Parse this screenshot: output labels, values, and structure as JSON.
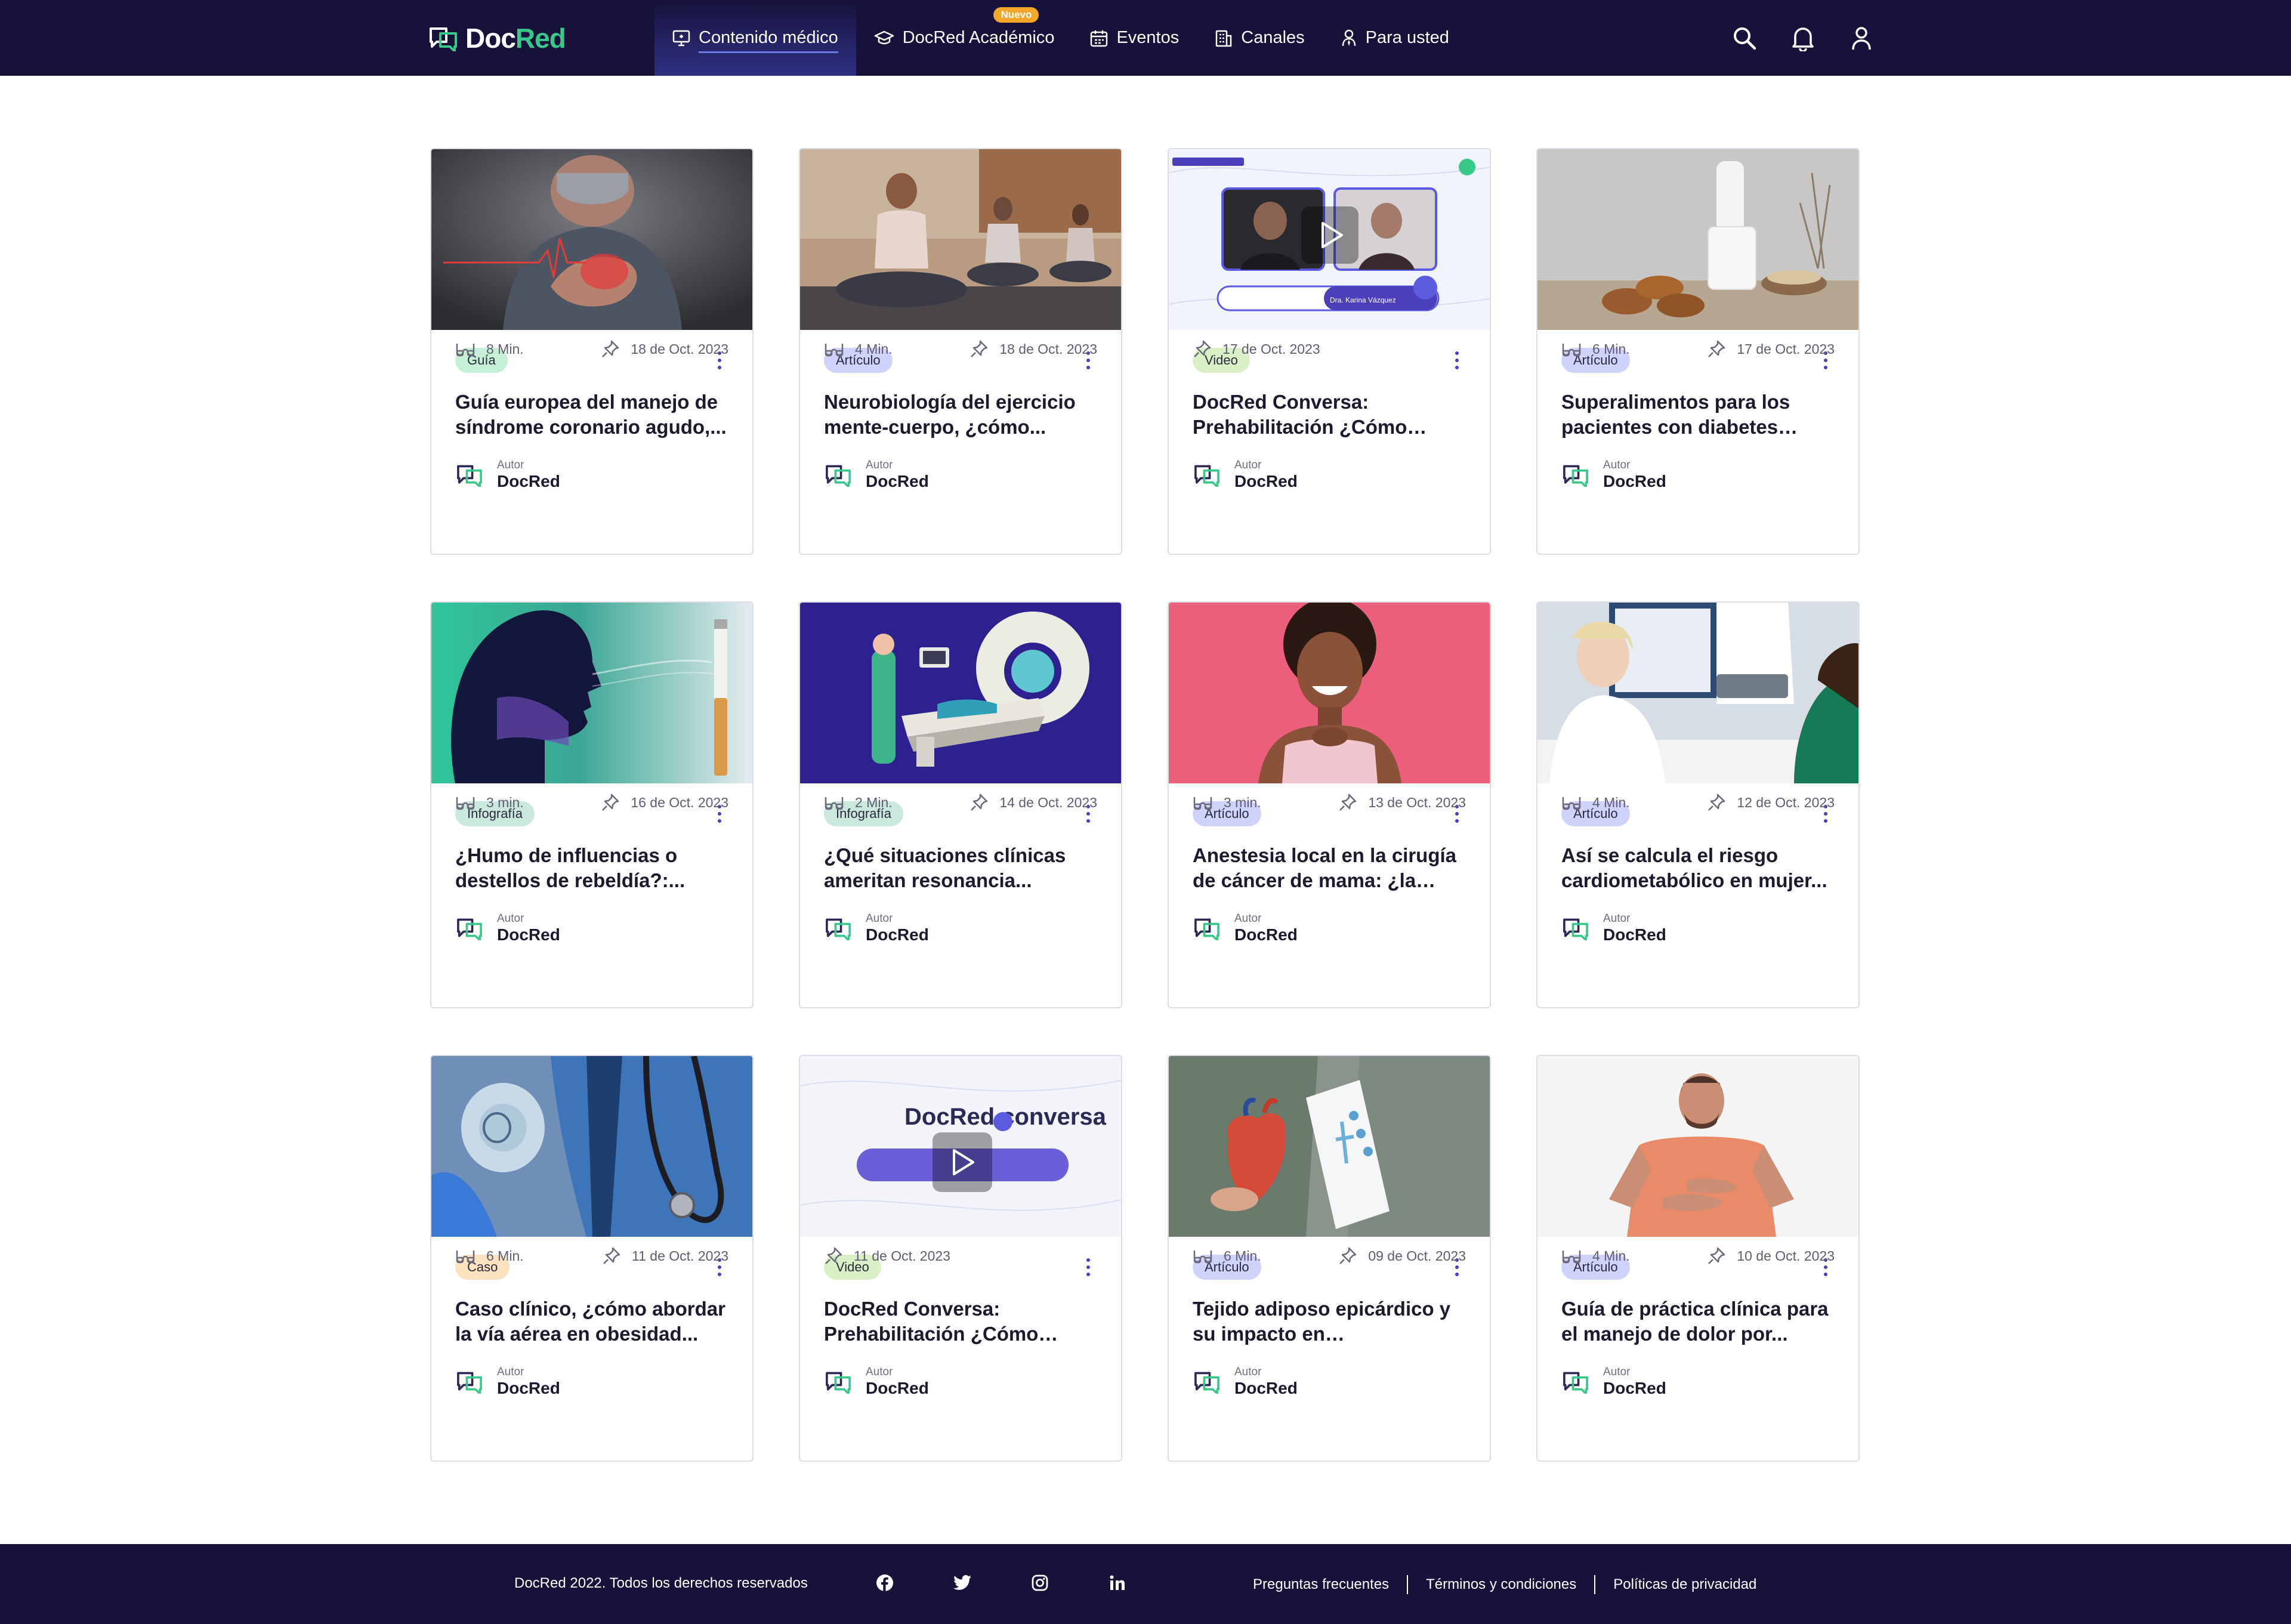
{
  "header": {
    "logo": {
      "part1": "Doc",
      "part2": "Red"
    },
    "nav": [
      {
        "label": "Contenido médico",
        "icon": "monitor-icon",
        "active": true
      },
      {
        "label": "DocRed Académico",
        "icon": "graduation-cap-icon",
        "badge": "Nuevo"
      },
      {
        "label": "Eventos",
        "icon": "calendar-icon"
      },
      {
        "label": "Canales",
        "icon": "building-icon"
      },
      {
        "label": "Para usted",
        "icon": "person-icon"
      }
    ],
    "actions": [
      "search-icon",
      "bell-icon",
      "user-icon"
    ]
  },
  "colors": {
    "header_bg": "#16123a",
    "brand_green": "#37c98a",
    "accent_purple": "#4b3fbb",
    "tag_guia": "#c6f0d6",
    "tag_articulo": "#cfd3fb",
    "tag_video": "#d9f0c6",
    "tag_infografia": "#cbe8dc",
    "tag_caso": "#fde2c0"
  },
  "cards": [
    {
      "tag": "Guía",
      "title": "Guía europea del manejo de síndrome coronario agudo,...",
      "author_label": "Autor",
      "author": "DocRed",
      "duration": "8 Min.",
      "date": "18 de Oct. 2023",
      "image": "chest-pain-man"
    },
    {
      "tag": "Artículo",
      "title": "Neurobiología del ejercicio mente-cuerpo, ¿cómo...",
      "author_label": "Autor",
      "author": "DocRed",
      "duration": "4 Min.",
      "date": "18 de Oct. 2023",
      "image": "yoga-class"
    },
    {
      "tag": "Video",
      "title": "DocRed Conversa: Prehabilitación ¿Cómo logra...",
      "author_label": "Autor",
      "author": "DocRed",
      "duration": "",
      "date": "17 de Oct. 2023",
      "image": "video-call",
      "image_caption": "Dra. Karina Vázquez"
    },
    {
      "tag": "Artículo",
      "title": "Superalimentos para los pacientes con diabetes tipo...",
      "author_label": "Autor",
      "author": "DocRed",
      "duration": "6 Min.",
      "date": "17 de Oct. 2023",
      "image": "milk-cookies"
    },
    {
      "tag": "Infografía",
      "title": "¿Humo de influencias o destellos de rebeldía?:...",
      "author_label": "Autor",
      "author": "DocRed",
      "duration": "3 min.",
      "date": "16 de Oct. 2023",
      "image": "smoking-silhouette"
    },
    {
      "tag": "Infografía",
      "title": "¿Qué situaciones clínicas ameritan resonancia...",
      "author_label": "Autor",
      "author": "DocRed",
      "duration": "2 Min.",
      "date": "14 de Oct. 2023",
      "image": "mri-scanner"
    },
    {
      "tag": "Artículo",
      "title": "Anestesia local en la cirugía de cáncer de mama: ¿la clav...",
      "author_label": "Autor",
      "author": "DocRed",
      "duration": "3 min.",
      "date": "13 de Oct. 2023",
      "image": "smiling-woman"
    },
    {
      "tag": "Artículo",
      "title": "Así se calcula el riesgo cardiometabólico en mujer...",
      "author_label": "Autor",
      "author": "DocRed",
      "duration": "4 Min.",
      "date": "12 de Oct. 2023",
      "image": "doctor-consult"
    },
    {
      "tag": "Caso",
      "title": "Caso clínico, ¿cómo abordar la vía aérea en obesidad...",
      "author_label": "Autor",
      "author": "DocRed",
      "duration": "6 Min.",
      "date": "11 de Oct. 2023",
      "image": "oxygen-mask"
    },
    {
      "tag": "Video",
      "title": "DocRed Conversa: Prehabilitación ¿Cómo logra...",
      "author_label": "Autor",
      "author": "DocRed",
      "duration": "",
      "date": "11 de Oct. 2023",
      "image": "docred-conversa",
      "image_caption": "DocRed conversa"
    },
    {
      "tag": "Artículo",
      "title": "Tejido adiposo epicárdico y su impacto en insuficiencia...",
      "author_label": "Autor",
      "author": "DocRed",
      "duration": "6 Min.",
      "date": "09 de Oct. 2023",
      "image": "heart-model"
    },
    {
      "tag": "Artículo",
      "title": "Guía de práctica clínica para el manejo de dolor por...",
      "author_label": "Autor",
      "author": "DocRed",
      "duration": "4 Min.",
      "date": "10 de Oct. 2023",
      "image": "stomach-pain-man"
    }
  ],
  "footer": {
    "copyright": "DocRed 2022. Todos los derechos reservados",
    "socials": [
      "facebook-icon",
      "twitter-icon",
      "instagram-icon",
      "linkedin-icon"
    ],
    "links": [
      "Preguntas frecuentes",
      "Términos y condiciones",
      "Políticas de privacidad"
    ]
  }
}
